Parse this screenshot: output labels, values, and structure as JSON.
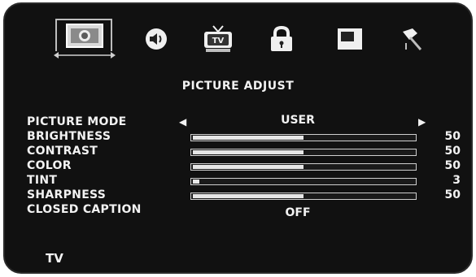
{
  "menu": {
    "tabs": [
      {
        "id": "picture",
        "icon": "picture-icon",
        "selected": true
      },
      {
        "id": "audio",
        "icon": "speaker-icon"
      },
      {
        "id": "tv",
        "icon": "tv-icon",
        "label": "TV"
      },
      {
        "id": "lock",
        "icon": "lock-icon"
      },
      {
        "id": "setup",
        "icon": "window-icon"
      },
      {
        "id": "settings",
        "icon": "tools-icon"
      }
    ],
    "title": "PICTURE ADJUST",
    "rows": [
      {
        "label": "PICTURE MODE",
        "value": "USER",
        "type": "select"
      },
      {
        "label": "BRIGHTNESS",
        "value": "50",
        "level": 0.5,
        "type": "slider"
      },
      {
        "label": "CONTRAST",
        "value": "50",
        "level": 0.5,
        "type": "slider"
      },
      {
        "label": "COLOR",
        "value": "50",
        "level": 0.5,
        "type": "slider"
      },
      {
        "label": "TINT",
        "value": "3",
        "level": 0.03,
        "type": "slider"
      },
      {
        "label": "SHARPNESS",
        "value": "50",
        "level": 0.5,
        "type": "slider"
      },
      {
        "label": "CLOSED CAPTION",
        "value": "OFF",
        "type": "toggle"
      }
    ],
    "source": "TV"
  },
  "colors": {
    "background": "#111111",
    "text": "#f2f2f2",
    "bar_fill": "#e6e6e6"
  }
}
